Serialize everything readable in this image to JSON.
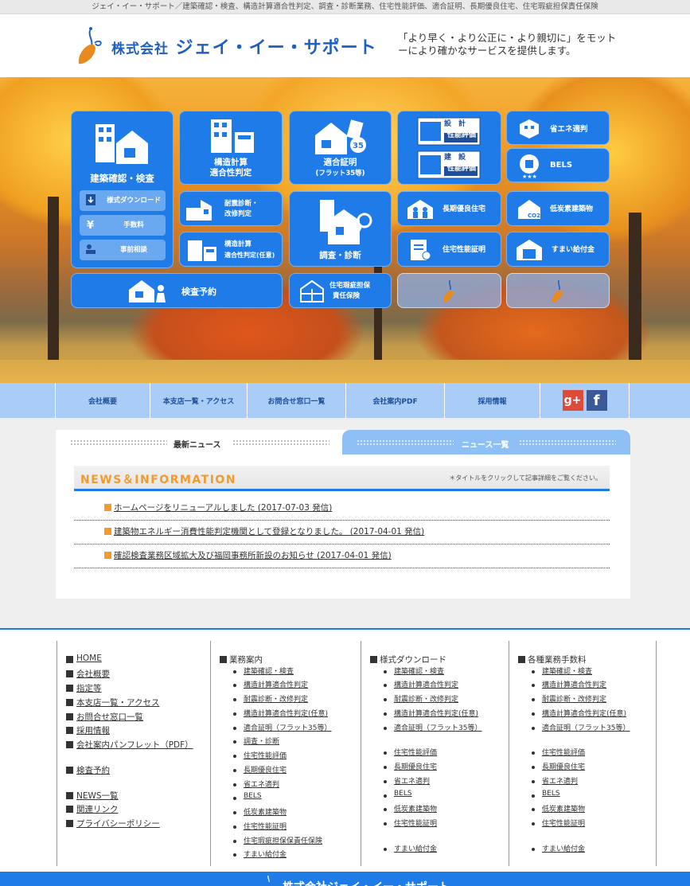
{
  "topbar": {
    "text": "ジェイ・イー・サポート／建築確認・検査、構造計算適合性判定、調査・診断業務、住宅性能評価、適合証明、長期優良住宅、住宅瑕疵担保責任保険"
  },
  "header": {
    "company_prefix": "株式会社",
    "company_name": "ジェイ・イー・サポート",
    "motto": "「より早く・より公正に・より親切に」をモットーにより確かなサービスを提供します。"
  },
  "tiles": {
    "kakunin": "建築確認・検査",
    "download": "様式ダウンロード",
    "fee": "手数料",
    "consult": "事前相談",
    "kozo_1": "構造計算",
    "kozo_2": "適合性判定",
    "tekigo_1": "適合証明",
    "tekigo_2": "(フラット35等)",
    "sekkei_1": "設　計",
    "sekkei_2": "性能評価",
    "kensetsu_1": "建　設",
    "kensetsu_2": "性能評価",
    "shoene": "省エネ適判",
    "bels": "BELS",
    "taishin_1": "耐震診断・",
    "taishin_2": "改修判定",
    "nini_1": "構造計算",
    "nini_2": "適合性判定(任意)",
    "chosa": "調査・診断",
    "choki": "長期優良住宅",
    "teitanso": "低炭素建築物",
    "jutaku": "住宅性能証明",
    "sumai": "すまい給付金",
    "yoyaku": "検査予約",
    "kashi_1": "住宅瑕疵担保",
    "kashi_2": "責任保険",
    "co2": "CO2",
    "badge35": "35"
  },
  "nav": {
    "items": [
      "会社概要",
      "本支店一覧・アクセス",
      "お問合せ窓口一覧",
      "会社案内PDF",
      "採用情報"
    ],
    "gplus": "g+",
    "fb": "f"
  },
  "news": {
    "tab_active": "最新ニュース",
    "tab_inactive": "ニュース一覧",
    "heading": "NEWS＆INFORMATION",
    "note": "＊タイトルをクリックして記事詳細をご覧ください。",
    "items": [
      "ホームページをリニューアルしました (2017-07-03 発信)",
      "建築物エネルギー消費性能判定機関として登録となりました。 (2017-04-01 発信)",
      "確認検査業務区域拡大及び福岡事務所新設のお知らせ (2017-04-01 発信)"
    ]
  },
  "footer": {
    "col1": [
      "HOME",
      "会社概要",
      "指定等",
      "本支店一覧・アクセス",
      "お問合せ窓口一覧",
      "採用情報",
      "会社案内パンフレット（PDF）",
      "検査予約",
      "NEWS一覧",
      "関連リンク",
      "プライバシーポリシー"
    ],
    "col2_head": "業務案内",
    "col2": [
      "建築確認・検査",
      "構造計算適合性判定",
      "耐震診断・改修判定",
      "構造計算適合性判定(任意)",
      "適合証明（フラット35等）",
      "調査・診断",
      "住宅性能評価",
      "長期優良住宅",
      "省エネ適判",
      "BELS",
      "低炭素建築物",
      "住宅性能証明",
      "住宅瑕疵担保保責任保険",
      "すまい給付金"
    ],
    "col3_head": "様式ダウンロード",
    "col3": [
      "建築確認・検査",
      "構造計算適合性判定",
      "耐震診断・改修判定",
      "構造計算適合性判定(任意)",
      "適合証明（フラット35等）",
      "住宅性能評価",
      "長期優良住宅",
      "省エネ適判",
      "BELS",
      "低炭素建築物",
      "住宅性能証明",
      "すまい給付金"
    ],
    "col4_head": "各種業務手数料",
    "col4": [
      "建築確認・検査",
      "構造計算適合性判定",
      "耐震診断・改修判定",
      "構造計算適合性判定(任意)",
      "適合証明（フラット35等）",
      "住宅性能評価",
      "長期優良住宅",
      "省エネ適判",
      "BELS",
      "低炭素建築物",
      "住宅性能証明",
      "すまい給付金"
    ]
  },
  "bottom": {
    "company": "株式会社ジェイ・イー・サポート"
  },
  "colors": {
    "accent": "#1f7be8",
    "orange": "#f29a2b",
    "nav": "#a9cdf7"
  }
}
